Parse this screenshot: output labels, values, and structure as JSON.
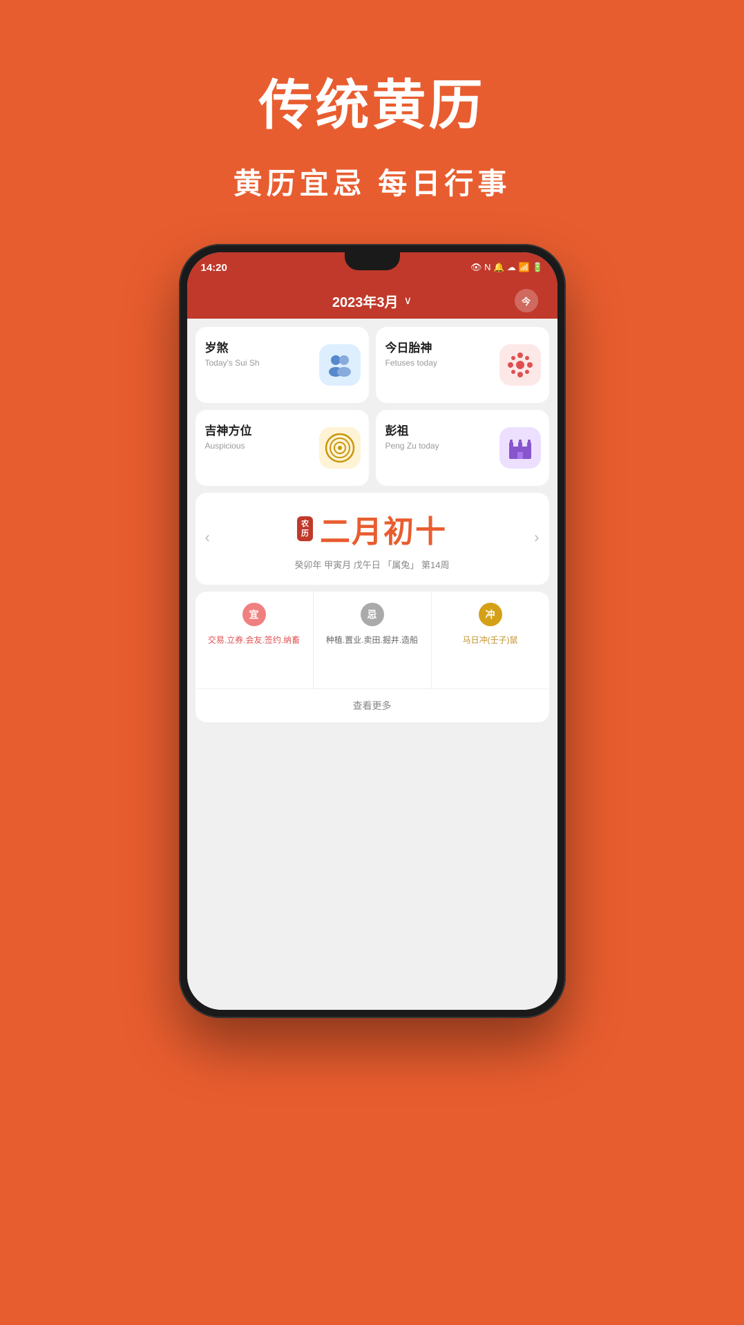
{
  "background": "#E85D2F",
  "app_title": "传统黄历",
  "app_subtitle": "黄历宜忌 每日行事",
  "status_bar": {
    "time": "14:20",
    "icons": "👁 N 🔔 📶 5G"
  },
  "header": {
    "title": "2023年3月",
    "chevron": "∨",
    "today_btn": "今"
  },
  "cards": [
    {
      "title_cn": "岁煞",
      "title_en": "Today's Sui Sh",
      "icon_type": "blue",
      "icon": "people"
    },
    {
      "title_cn": "今日胎神",
      "title_en": "Fetuses today",
      "icon_type": "pink",
      "icon": "molecule"
    },
    {
      "title_cn": "吉神方位",
      "title_en": "Auspicious",
      "icon_type": "yellow",
      "icon": "target"
    },
    {
      "title_cn": "彭祖",
      "title_en": "Peng Zu today",
      "icon_type": "purple",
      "icon": "castle"
    }
  ],
  "calendar": {
    "lunar_badge_line1": "农",
    "lunar_badge_line2": "历",
    "date_cn": "二月初十",
    "info": "癸卯年 甲寅月 戊午日 「属兔」 第14周",
    "nav_left": "‹",
    "nav_right": "›"
  },
  "yiji": {
    "yi_badge": "宜",
    "ji_badge": "忌",
    "chong_badge": "冲",
    "yi_text": "交易.立券.会友.签约.纳畜",
    "ji_text": "种植.置业.卖田.掘井.造船",
    "chong_text": "马日冲(壬子)鼠",
    "see_more": "查看更多"
  }
}
